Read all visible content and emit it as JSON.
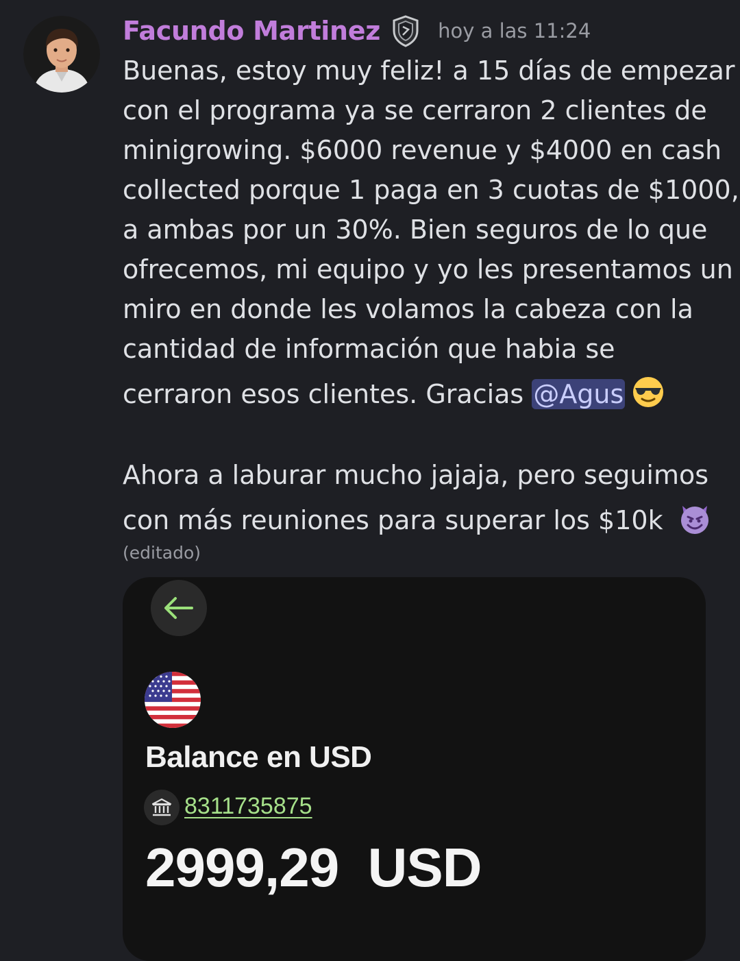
{
  "message": {
    "author": "Facundo Martinez",
    "timestamp": "hoy a las 11:24",
    "badge_icon": "shield-badge-icon",
    "lines": [
      "Buenas, estoy muy feliz! a 15 días de empezar",
      "con el programa ya se cerraron 2 clientes de",
      "minigrowing. $6000 revenue y $4000 en cash",
      "collected porque 1 paga en 3 cuotas de $1000,",
      "a ambas por un 30%. Bien seguros de lo que",
      "ofrecemos, mi equipo y yo les presentamos un",
      "miro en donde les volamos la cabeza con la",
      "cantidad de información que habia se"
    ],
    "line9_text": "cerraron esos clientes. Gracias ",
    "mention": "@Agus",
    "emoji_1": "smiling-face-with-sunglasses",
    "paragraph2_line1": "Ahora a laburar mucho jajaja, pero seguimos",
    "paragraph2_line2": "con más reuniones para superar los $10k ",
    "emoji_2": "smiling-face-with-horns",
    "edited_label": "(editado)"
  },
  "attachment": {
    "back_icon": "arrow-left-icon",
    "flag_icon": "us-flag-icon",
    "balance_title": "Balance en USD",
    "bank_icon": "bank-icon",
    "account_number": "8311735875",
    "amount": "2999,29  USD"
  },
  "colors": {
    "background": "#1e1f24",
    "author": "#c17ddb",
    "mention_bg": "#3c4278",
    "account_link": "#a6e08a",
    "back_arrow": "#9be07a"
  }
}
